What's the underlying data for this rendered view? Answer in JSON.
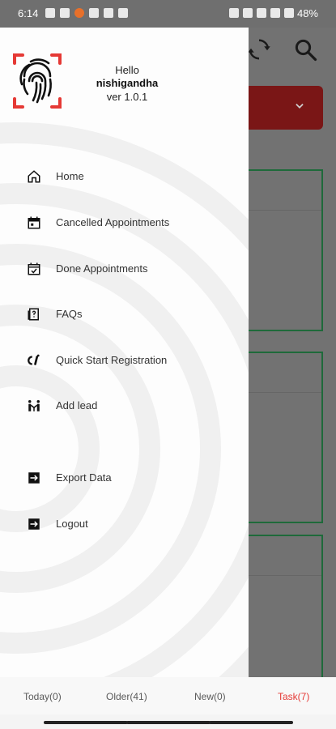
{
  "status_bar": {
    "time": "6:14",
    "battery": "48%",
    "left_icons": [
      "sim-icon",
      "notification-icon",
      "app-icon",
      "gallery-icon",
      "image-icon",
      "chrome-icon"
    ],
    "right_icons": [
      "alarm-icon",
      "mute-icon",
      "wifi-icon",
      "signal-icon",
      "battery-icon"
    ]
  },
  "drawer": {
    "greeting": "Hello",
    "username": "nishigandha",
    "version": "ver 1.0.1",
    "menu": [
      {
        "label": "Home",
        "icon": "home-icon"
      },
      {
        "label": "Cancelled Appointments",
        "icon": "calendar-cancel-icon"
      },
      {
        "label": "Done Appointments",
        "icon": "calendar-check-icon"
      },
      {
        "label": "FAQs",
        "icon": "faq-icon"
      },
      {
        "label": "Quick Start Registration",
        "icon": "quick-register-icon"
      },
      {
        "label": "Add lead",
        "icon": "add-lead-icon"
      },
      {
        "label": "Export Data",
        "icon": "export-icon"
      },
      {
        "label": "Logout",
        "icon": "logout-icon"
      }
    ]
  },
  "bottom_tabs": [
    {
      "label": "Today(0)",
      "active": false
    },
    {
      "label": "Older(41)",
      "active": false
    },
    {
      "label": "New(0)",
      "active": false
    },
    {
      "label": "Task(7)",
      "active": true
    }
  ],
  "colors": {
    "accent": "#e53935",
    "dropdown_bg": "#7a1616",
    "card_border": "#1e6a3a"
  }
}
